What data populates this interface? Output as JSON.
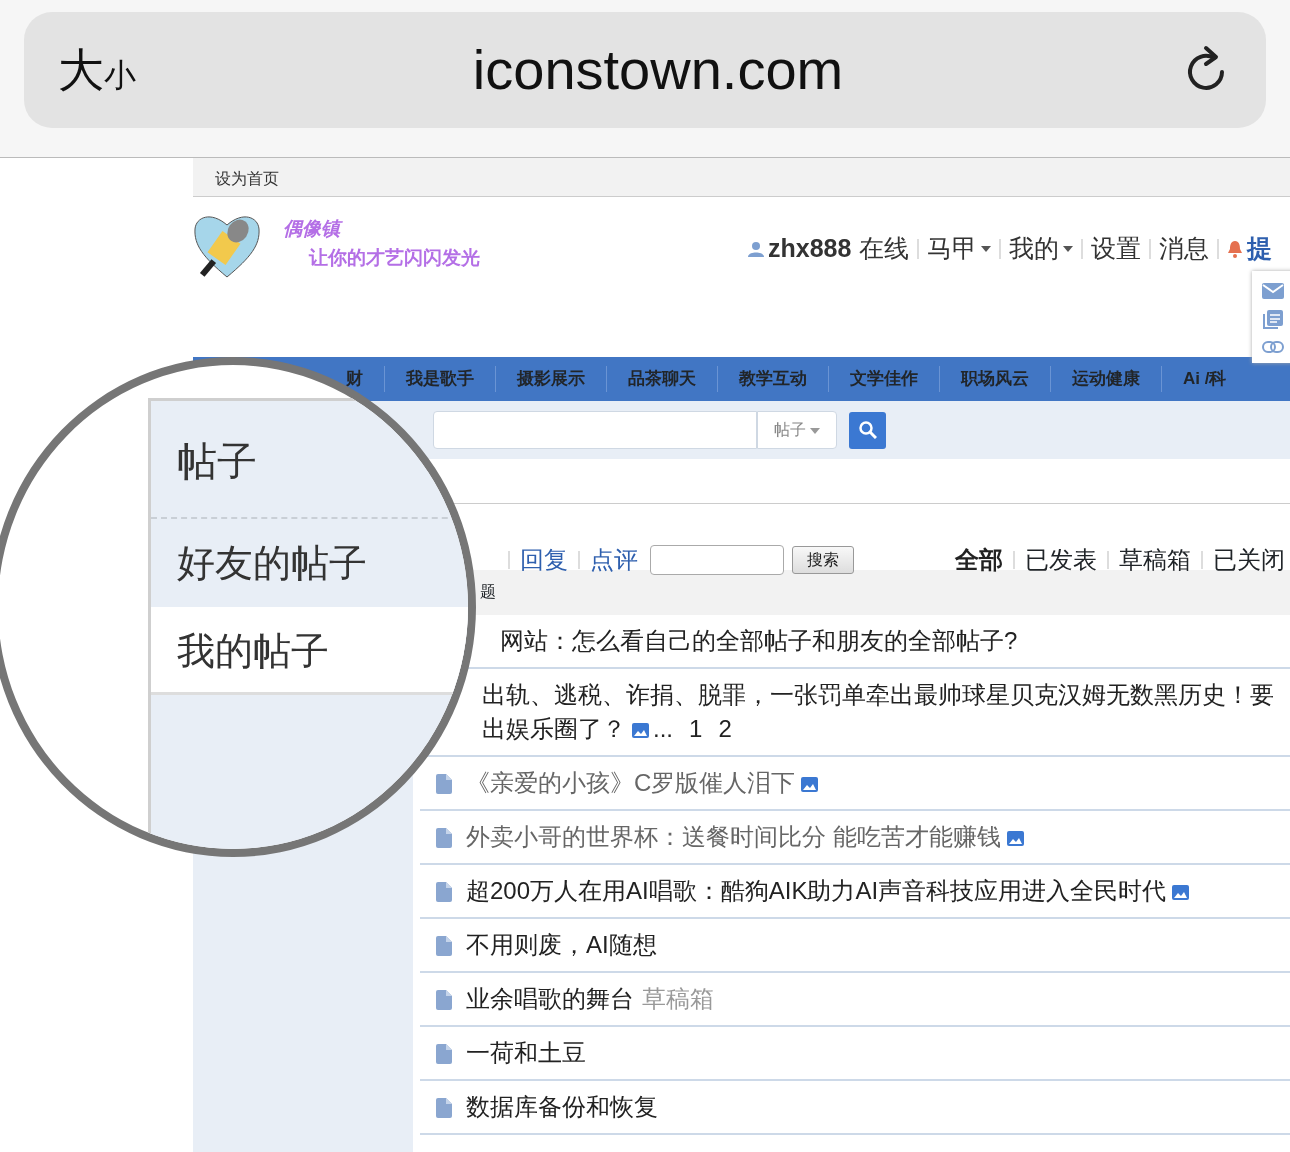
{
  "browser": {
    "text_size_button": {
      "large_letter": "大",
      "small_letter": "小"
    },
    "address": "iconstown.com"
  },
  "top_bar": {
    "link": "设为首页"
  },
  "logo": {
    "title": "偶像镇",
    "slogan": "让你的才艺闪闪发光"
  },
  "user_bar": {
    "username": "zhx888",
    "status": "在线",
    "items": [
      {
        "label": "马甲",
        "dropdown": true,
        "kind": "menu"
      },
      {
        "label": "我的",
        "dropdown": true,
        "kind": "menu"
      },
      {
        "label": "设置",
        "dropdown": false,
        "kind": "menu"
      },
      {
        "label": "消息",
        "dropdown": false,
        "kind": "menu"
      },
      {
        "label": "提",
        "dropdown": false,
        "kind": "alert"
      }
    ]
  },
  "nav": [
    "财",
    "我是歌手",
    "摄影展示",
    "品茶聊天",
    "教学互动",
    "文学佳作",
    "职场风云",
    "运动健康",
    "Ai /科"
  ],
  "search": {
    "scope": "帖子"
  },
  "filter": {
    "links": [
      "回复",
      "点评"
    ],
    "button": "搜索",
    "tabs": [
      {
        "label": "全部",
        "selected": true
      },
      {
        "label": "已发表",
        "selected": false
      },
      {
        "label": "草稿箱",
        "selected": false
      },
      {
        "label": "已关闭",
        "selected": false
      }
    ]
  },
  "table": {
    "column_header": "题",
    "rows": [
      {
        "title": "网站：怎么看自己的全部帖子和朋友的全部帖子?",
        "visited": false,
        "has_image": false
      },
      {
        "title": "出轨、逃税、诈捐、脱罪，一张罚单牵出最帅球星贝克汉姆无数黑历史！要",
        "continuation": "出娱乐圈了？",
        "visited": false,
        "has_image": true,
        "ellipsis": "...",
        "pages": [
          "1",
          "2"
        ]
      },
      {
        "title": "《亲爱的小孩》C罗版催人泪下",
        "visited": true,
        "has_image": true
      },
      {
        "title": "外卖小哥的世界杯：送餐时间比分 能吃苦才能赚钱",
        "visited": true,
        "has_image": true
      },
      {
        "title": "超200万人在用AI唱歌：酷狗AIK助力AI声音科技应用进入全民时代",
        "visited": false,
        "has_image": true
      },
      {
        "title": "不用则废，AI随想",
        "visited": false,
        "has_image": false
      },
      {
        "title": "业余唱歌的舞台",
        "visited": false,
        "has_image": false,
        "tag": "草稿箱"
      },
      {
        "title": "一荷和土豆",
        "visited": false,
        "has_image": false
      },
      {
        "title": "数据库备份和恢复",
        "visited": false,
        "has_image": false
      }
    ]
  },
  "magnifier": {
    "heading": "帖子",
    "items": [
      {
        "label": "好友的帖子",
        "selected": false
      },
      {
        "label": "我的帖子",
        "selected": true
      }
    ]
  }
}
